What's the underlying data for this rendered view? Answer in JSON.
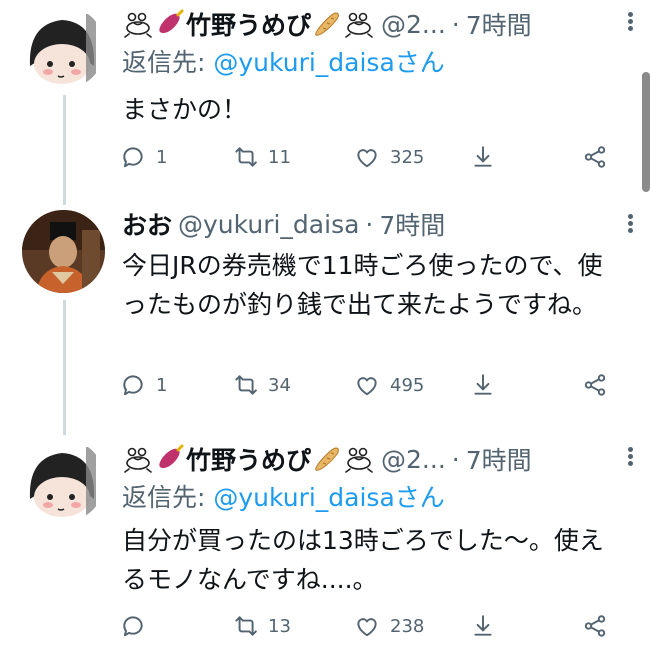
{
  "tweets": [
    {
      "name": "竹野うめぴ",
      "handle": "@2...",
      "time": "7時間",
      "reply_prefix": "返信先: ",
      "reply_mention": "@yukuri_daisa",
      "reply_suffix": "さん",
      "text": "まさかの！",
      "replies": "1",
      "retweets": "11",
      "likes": "325"
    },
    {
      "name": "おお",
      "handle": "@yukuri_daisa",
      "time": "7時間",
      "text": "今日JRの券売機で11時ごろ使ったので、使ったものが釣り銭で出て来たようですね。",
      "replies": "1",
      "retweets": "34",
      "likes": "495"
    },
    {
      "name": "竹野うめぴ",
      "handle": "@2...",
      "time": "7時間",
      "reply_prefix": "返信先: ",
      "reply_mention": "@yukuri_daisa",
      "reply_suffix": "さん",
      "text": "自分が買ったのは13時ごろでした〜。使えるモノなんですね....。",
      "replies": "",
      "retweets": "13",
      "likes": "238"
    }
  ],
  "sep": "·",
  "colors": {
    "accent": "#1d9bf0",
    "secondary": "#536471",
    "text": "#0f1419",
    "thread": "#cfd9de"
  },
  "icons": [
    "reply-icon",
    "retweet-icon",
    "like-icon",
    "share-icon",
    "share-network-icon",
    "more-icon",
    "frog-emoji",
    "sweet-potato-emoji",
    "bread-emoji"
  ]
}
